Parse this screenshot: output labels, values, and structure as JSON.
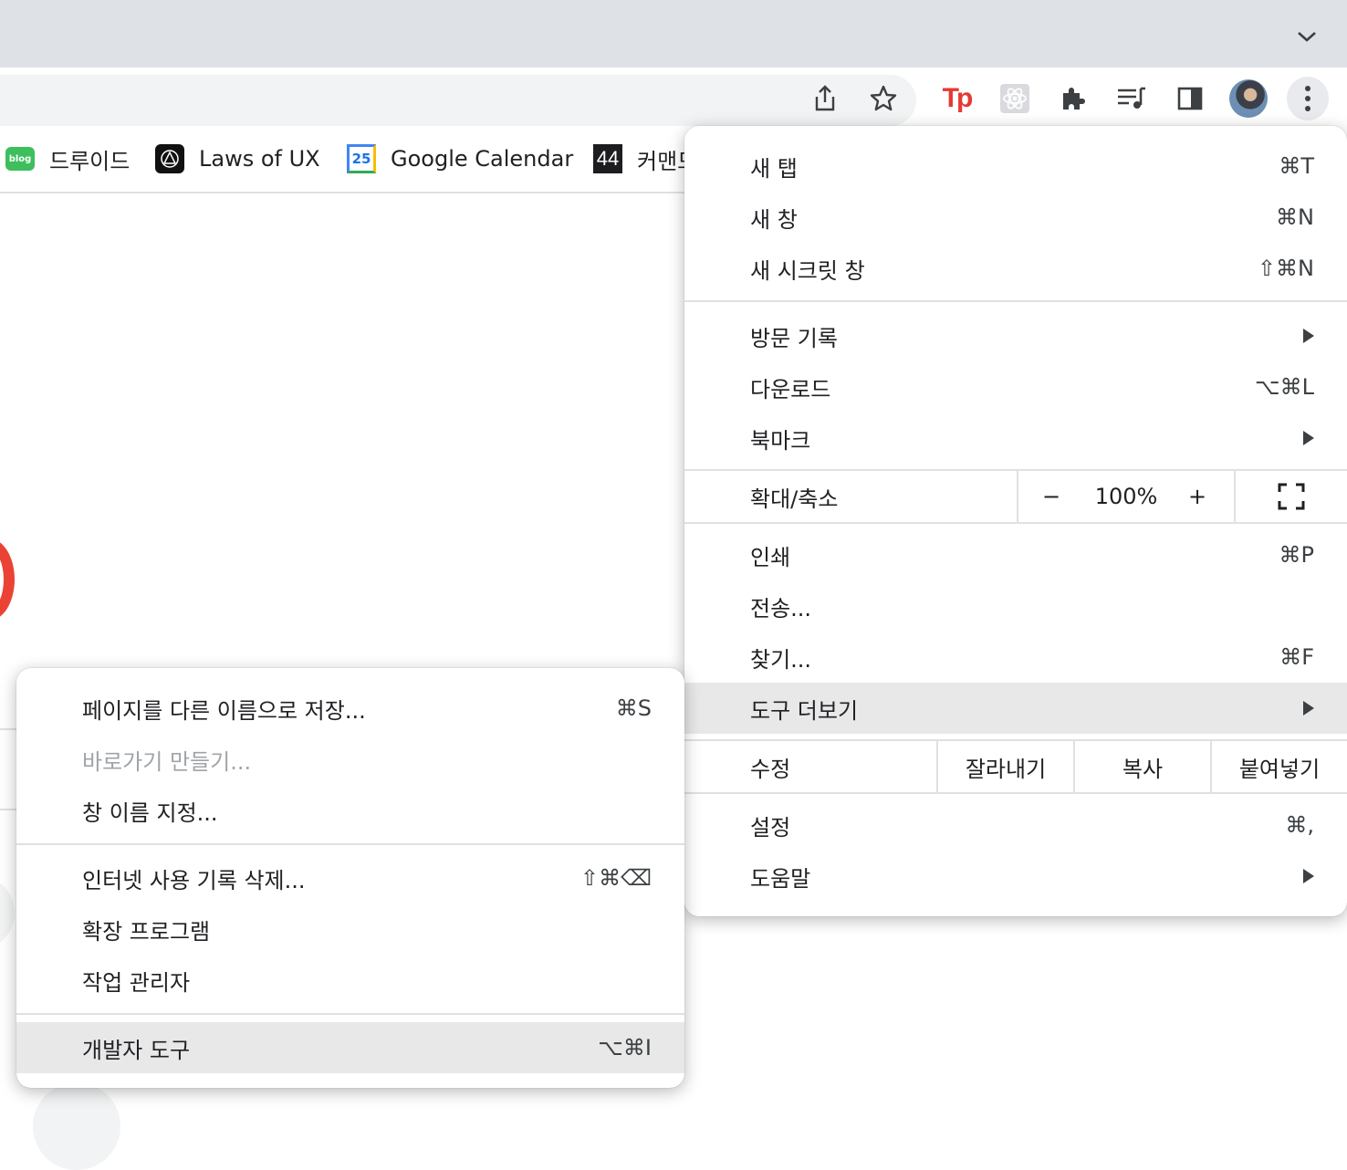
{
  "bookmarks": [
    {
      "label": "드루이드",
      "icon": "blog-icon",
      "icon_text": "blog"
    },
    {
      "label": "Laws of UX",
      "icon": "laws-of-ux-icon"
    },
    {
      "label": "Google Calendar",
      "icon": "calendar-icon",
      "icon_text": "25"
    },
    {
      "label": "커맨드",
      "icon": "number-44-icon",
      "icon_text": "44"
    }
  ],
  "toolbar": {
    "extension_tp_text": "Tp"
  },
  "main_menu": {
    "new_tab": {
      "label": "새 탭",
      "shortcut": "⌘T"
    },
    "new_window": {
      "label": "새 창",
      "shortcut": "⌘N"
    },
    "new_incognito": {
      "label": "새 시크릿 창",
      "shortcut": "⇧⌘N"
    },
    "history": {
      "label": "방문 기록"
    },
    "downloads": {
      "label": "다운로드",
      "shortcut": "⌥⌘L"
    },
    "bookmarks": {
      "label": "북마크"
    },
    "zoom": {
      "label": "확대/축소",
      "minus": "−",
      "value": "100%",
      "plus": "+"
    },
    "print": {
      "label": "인쇄",
      "shortcut": "⌘P"
    },
    "cast": {
      "label": "전송..."
    },
    "find": {
      "label": "찾기...",
      "shortcut": "⌘F"
    },
    "more_tools": {
      "label": "도구 더보기"
    },
    "edit": {
      "label": "수정",
      "cut": "잘라내기",
      "copy": "복사",
      "paste": "붙여넣기"
    },
    "settings": {
      "label": "설정",
      "shortcut": "⌘,"
    },
    "help": {
      "label": "도움말"
    }
  },
  "sub_menu": {
    "save_page": {
      "label": "페이지를 다른 이름으로 저장...",
      "shortcut": "⌘S"
    },
    "create_shortcut": {
      "label": "바로가기 만들기..."
    },
    "name_window": {
      "label": "창 이름 지정..."
    },
    "clear_data": {
      "label": "인터넷 사용 기록 삭제...",
      "shortcut": "⇧⌘⌫"
    },
    "extensions": {
      "label": "확장 프로그램"
    },
    "task_manager": {
      "label": "작업 관리자"
    },
    "dev_tools": {
      "label": "개발자 도구",
      "shortcut": "⌥⌘I"
    }
  },
  "colors": {
    "tabstrip": "#dee1e6",
    "highlight": "#e8e8e9",
    "accent_red": "#ea4335"
  }
}
